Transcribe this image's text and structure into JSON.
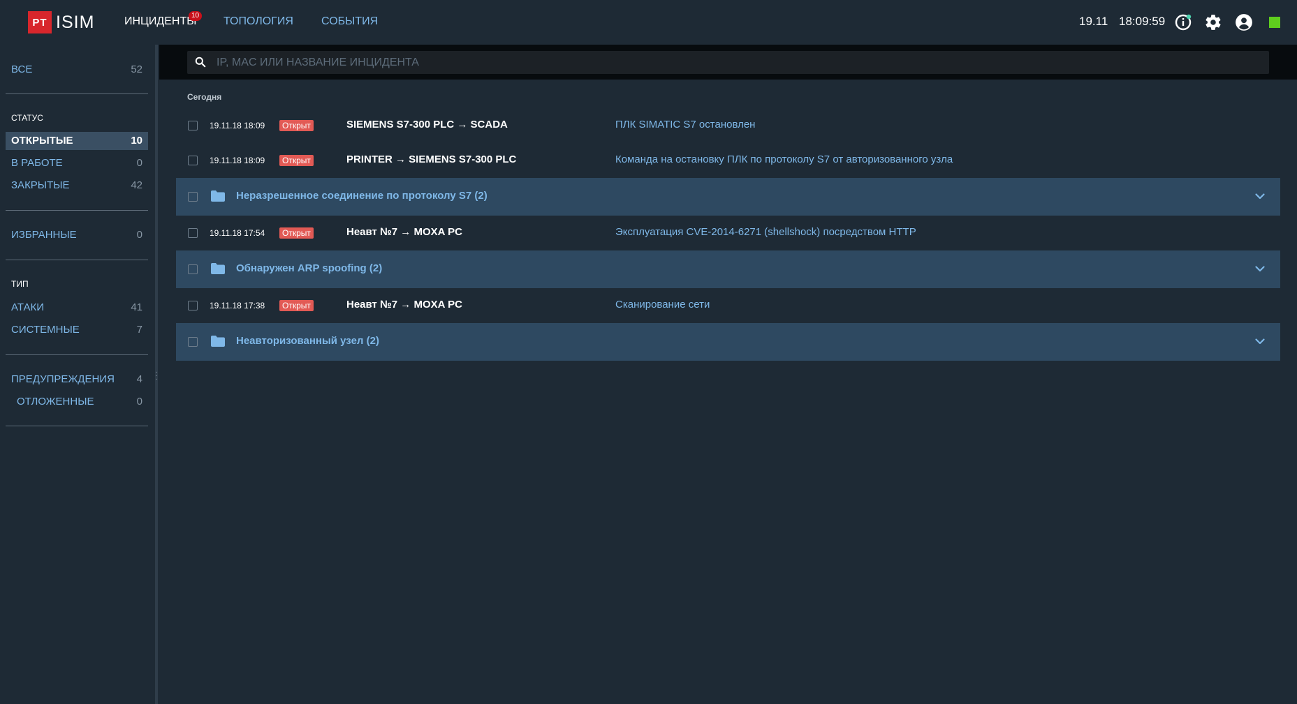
{
  "header": {
    "logo_mark": "PT",
    "logo_text": "ISIM",
    "nav": [
      {
        "label": "ИНЦИДЕНТЫ",
        "badge": "10",
        "active": true
      },
      {
        "label": "ТОПОЛОГИЯ",
        "active": false
      },
      {
        "label": "СОБЫТИЯ",
        "active": false
      }
    ],
    "date": "19.11",
    "time": "18:09:59",
    "icons": [
      "info-icon",
      "gear-icon",
      "user-icon"
    ],
    "status_color": "#5fce1e"
  },
  "search": {
    "placeholder": "IP, MAC ИЛИ НАЗВАНИЕ ИНЦИДЕНТА",
    "value": ""
  },
  "sidebar": {
    "all": {
      "label": "ВСЕ",
      "count": "52"
    },
    "status_heading": "СТАТУС",
    "status_items": [
      {
        "label": "ОТКРЫТЫЕ",
        "count": "10",
        "active": true
      },
      {
        "label": "В РАБОТЕ",
        "count": "0"
      },
      {
        "label": "ЗАКРЫТЫЕ",
        "count": "42"
      }
    ],
    "favorites": {
      "label": "ИЗБРАННЫЕ",
      "count": "0"
    },
    "type_heading": "ТИП",
    "type_items": [
      {
        "label": "АТАКИ",
        "count": "41"
      },
      {
        "label": "СИСТЕМНЫЕ",
        "count": "7"
      }
    ],
    "warnings": {
      "label": "ПРЕДУПРЕЖДЕНИЯ",
      "count": "4"
    },
    "postponed": {
      "label": "ОТЛОЖЕННЫЕ",
      "count": "0"
    }
  },
  "main": {
    "section_label": "Сегодня",
    "rows": [
      {
        "kind": "incident",
        "time": "19.11.18 18:09",
        "status": "Открыт",
        "route": "SIEMENS S7-300 PLC → SCADA",
        "title": "ПЛК SIMATIC S7 остановлен"
      },
      {
        "kind": "incident",
        "time": "19.11.18 18:09",
        "status": "Открыт",
        "route": "PRINTER → SIEMENS S7-300 PLC",
        "title": "Команда на остановку ПЛК по протоколу S7 от авторизованного узла"
      },
      {
        "kind": "group",
        "title": "Неразрешенное соединение по протоколу S7 (2)"
      },
      {
        "kind": "incident",
        "time": "19.11.18 17:54",
        "status": "Открыт",
        "route": "Неавт №7 → MOXA PC",
        "title": "Эксплуатация CVE-2014-6271 (shellshock) посредством HTTP"
      },
      {
        "kind": "group",
        "title": "Обнаружен ARP spoofing (2)"
      },
      {
        "kind": "incident",
        "time": "19.11.18 17:38",
        "status": "Открыт",
        "route": "Неавт №7 → MOXA PC",
        "title": "Сканирование сети"
      },
      {
        "kind": "group",
        "title": "Неавторизованный узел (2)"
      }
    ]
  },
  "colors": {
    "background": "#1e2a35",
    "accent_link": "#7fb8e8",
    "group_row": "#2e4961",
    "status_badge": "#e25a55",
    "logo_red": "#d8262c"
  }
}
